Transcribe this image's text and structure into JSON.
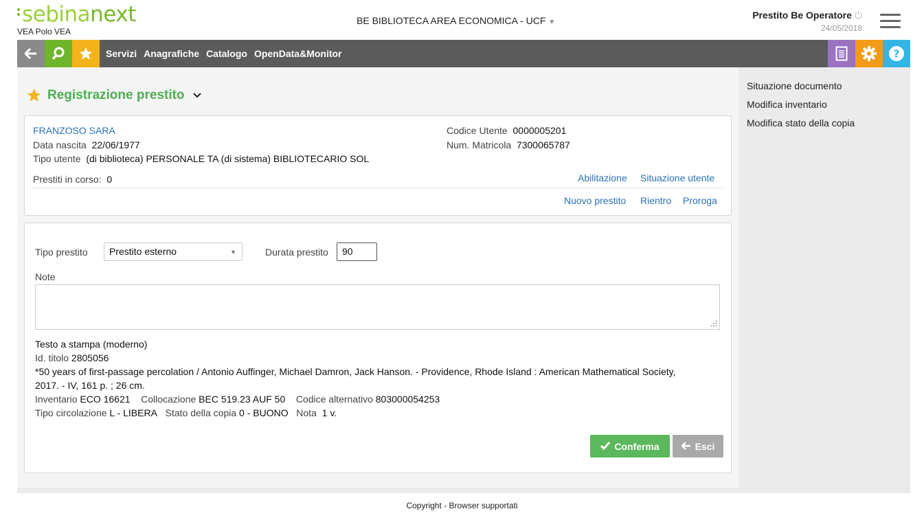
{
  "header": {
    "logo_part1": "sebina",
    "logo_part2": "next",
    "polo": "VEA Polo VEA",
    "library": "BE BIBLIOTECA AREA ECONOMICA - UCF",
    "operator_name": "Prestito Be Operatore",
    "date": "24/05/2018"
  },
  "toolbar": {
    "menu": [
      "Servizi",
      "Anagrafiche",
      "Catalogo",
      "OpenData&Monitor"
    ],
    "colors": {
      "back": "#8a8a8a",
      "search": "#6fb52c",
      "star": "#f4b21b",
      "doc": "#9a72c4",
      "gear": "#f39a16",
      "help": "#33b5e5"
    }
  },
  "page": {
    "title": "Registrazione prestito"
  },
  "user": {
    "name": "FRANZOSO SARA",
    "birth_label": "Data nascita",
    "birth_value": "22/06/1977",
    "type_label": "Tipo utente",
    "type_value": "(di biblioteca) PERSONALE TA (di sistema) BIBLIOTECARIO SOL",
    "code_label": "Codice Utente",
    "code_value": "0000005201",
    "matricola_label": "Num. Matricola",
    "matricola_value": "7300065787",
    "loans_label": "Prestiti in corso:",
    "loans_value": "0",
    "links_top": [
      "Abilitazione",
      "Situazione utente"
    ],
    "links_bottom": [
      "Nuovo prestito",
      "Rientro",
      "Proroga"
    ]
  },
  "form": {
    "tipo_label": "Tipo prestito",
    "tipo_value": "Prestito esterno",
    "durata_label": "Durata prestito",
    "durata_value": "90",
    "note_label": "Note",
    "note_value": ""
  },
  "document": {
    "material": "Testo a stampa (moderno)",
    "id_label": "Id. titolo",
    "id_value": "2805056",
    "description_line1": "*50 years of first-passage percolation / Antonio Auffinger, Michael Damron, Jack Hanson. - Providence, Rhode Island : American Mathematical Society,",
    "description_line2": "2017. - IV, 161 p. ; 26 cm.",
    "inventario_label": "Inventario",
    "inventario_value": "ECO 16621",
    "collocazione_label": "Collocazione",
    "collocazione_value": "BEC 519.23 AUF 50",
    "codalt_label": "Codice alternativo",
    "codalt_value": "803000054253",
    "circ_label": "Tipo circolazione",
    "circ_value": "L - LIBERA",
    "stato_label": "Stato della copia",
    "stato_value": "0 - BUONO",
    "nota_label": "Nota",
    "nota_value": "1 v."
  },
  "buttons": {
    "confirm": "Conferma",
    "exit": "Esci"
  },
  "sidebar": {
    "links": [
      "Situazione documento",
      "Modifica inventario",
      "Modifica stato della copia"
    ]
  },
  "footer": {
    "copyright": "Copyright",
    "separator": " - ",
    "browsers": "Browser supportati"
  }
}
